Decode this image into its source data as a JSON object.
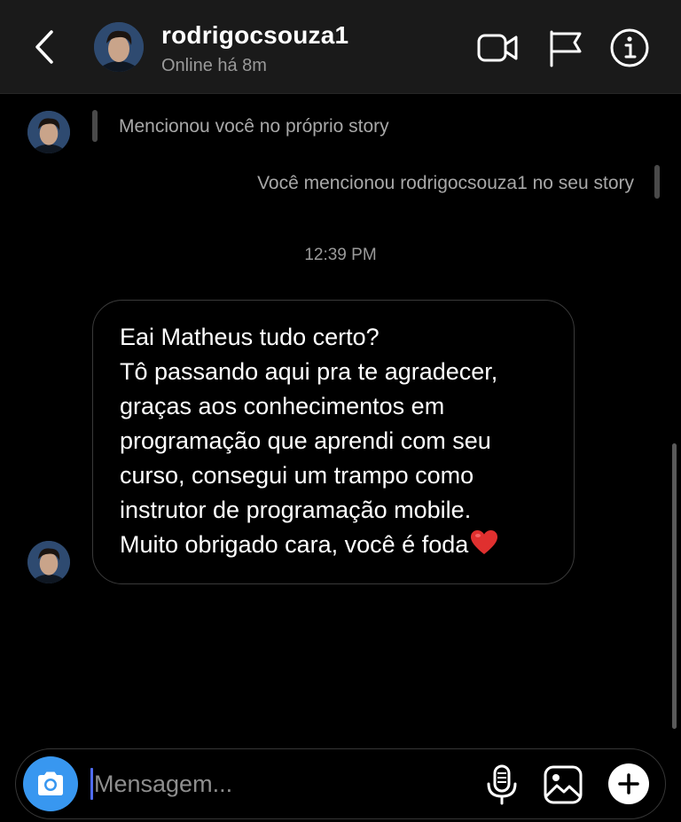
{
  "header": {
    "username": "rodrigocsouza1",
    "status": "Online há 8m",
    "icons": {
      "back": "chevron-left-icon",
      "video": "video-camera-icon",
      "report": "flag-icon",
      "info": "info-icon"
    }
  },
  "story_mentions": [
    {
      "side": "left",
      "text": "Mencionou você no próprio story"
    },
    {
      "side": "right",
      "text": "Você mencionou rodrigocsouza1 no seu story"
    }
  ],
  "timestamp": "12:39 PM",
  "message": {
    "lines": [
      "Eai Matheus tudo certo?",
      "Tô passando aqui pra te agradecer,",
      "graças aos conhecimentos em",
      "programação que aprendi com seu",
      "curso, consegui um trampo como",
      "instrutor de programação mobile.",
      "Muito obrigado cara, você é foda"
    ],
    "emoji": "heart-icon"
  },
  "composer": {
    "placeholder": "Mensagem...",
    "value": "",
    "icons": [
      "camera-icon",
      "microphone-icon",
      "gallery-icon",
      "plus-icon"
    ]
  },
  "colors": {
    "background": "#000000",
    "header_bg": "#1a1a1a",
    "accent": "#3897f0",
    "heart": "#e0302f",
    "muted_text": "#a8a8a8"
  }
}
